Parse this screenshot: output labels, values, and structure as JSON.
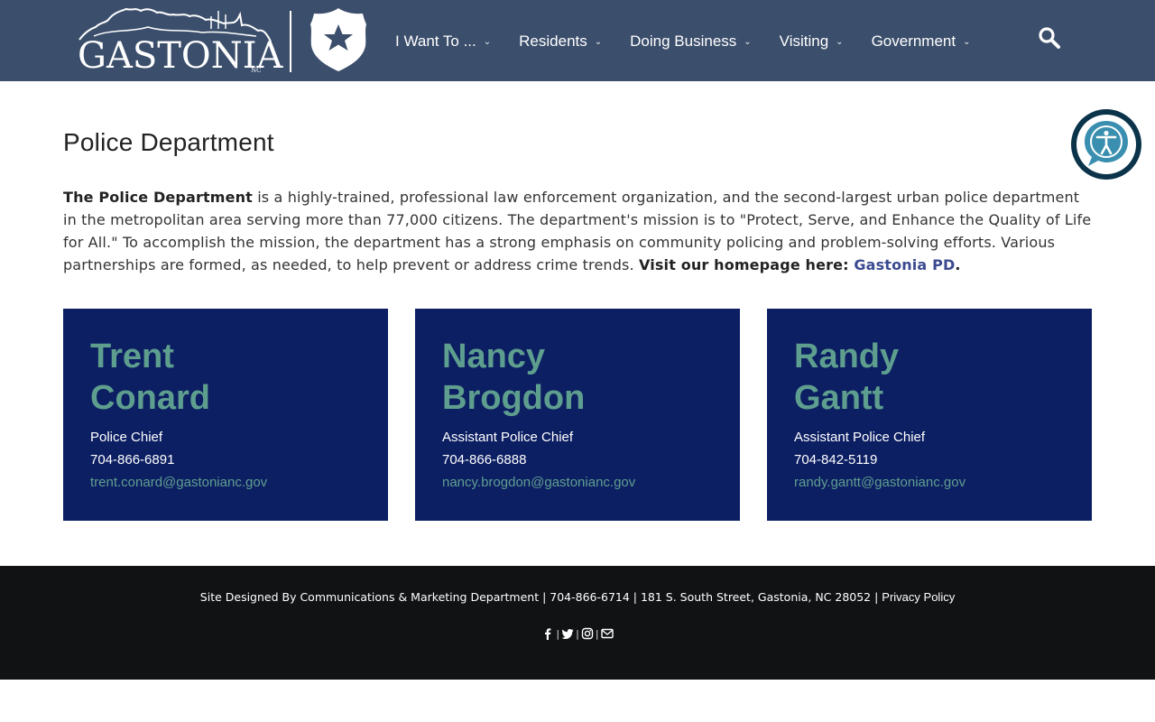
{
  "header": {
    "logo_text": "GASTONIA",
    "logo_suffix": "NC",
    "nav": [
      {
        "label": "I Want To ...",
        "icon": "chevron-down-icon"
      },
      {
        "label": "Residents",
        "icon": "chevron-down-icon"
      },
      {
        "label": "Doing Business",
        "icon": "chevron-down-icon"
      },
      {
        "label": "Visiting",
        "icon": "chevron-down-icon"
      },
      {
        "label": "Government",
        "icon": "chevron-down-icon"
      }
    ],
    "search_icon": "search-icon",
    "colors": {
      "bar": "#3b4e6b",
      "text": "#ffffff"
    }
  },
  "main": {
    "title": "Police Department",
    "intro": {
      "lead": "The Police Department",
      "body": " is a highly-trained, professional law enforcement organization, and the second-largest urban police department in the metropolitan area serving more than 77,000 citizens. The department's mission is to \"Protect, Serve, and Enhance the Quality of Life for All.\" To accomplish the mission, the department has a strong emphasis on community policing and problem-solving efforts. Various partnerships are formed, as needed, to help prevent or address crime trends. ",
      "cta": "Visit our homepage here: ",
      "link": "Gastonia PD",
      "end": "."
    },
    "cards": [
      {
        "first": "Trent",
        "last": "Conard",
        "role": "Police Chief",
        "phone": "704-866-6891",
        "email": "trent.conard@gastonianc.gov"
      },
      {
        "first": "Nancy",
        "last": "Brogdon",
        "role": "Assistant Police Chief",
        "phone": "704-866-6888",
        "email": "nancy.brogdon@gastonianc.gov"
      },
      {
        "first": "Randy",
        "last": "Gantt",
        "role": "Assistant Police Chief",
        "phone": "704-842-5119",
        "email": "randy.gantt@gastonianc.gov"
      }
    ],
    "colors": {
      "card_bg": "#0d1f63",
      "card_name": "#5e9e8e",
      "link": "#3a4a90"
    }
  },
  "accessibility": {
    "icon": "accessibility-icon",
    "colors": {
      "ring": "#0b3349",
      "fill": "#3a8fb0"
    }
  },
  "footer": {
    "text": "Site Designed By Communications & Marketing Department | 704-866-6714 | 181 S. South Street, Gastonia, NC 28052 | ",
    "privacy": "Privacy Policy",
    "social": [
      "facebook-icon",
      "twitter-icon",
      "instagram-icon",
      "email-icon"
    ],
    "colors": {
      "bg": "#111214",
      "text": "#ffffff"
    }
  }
}
